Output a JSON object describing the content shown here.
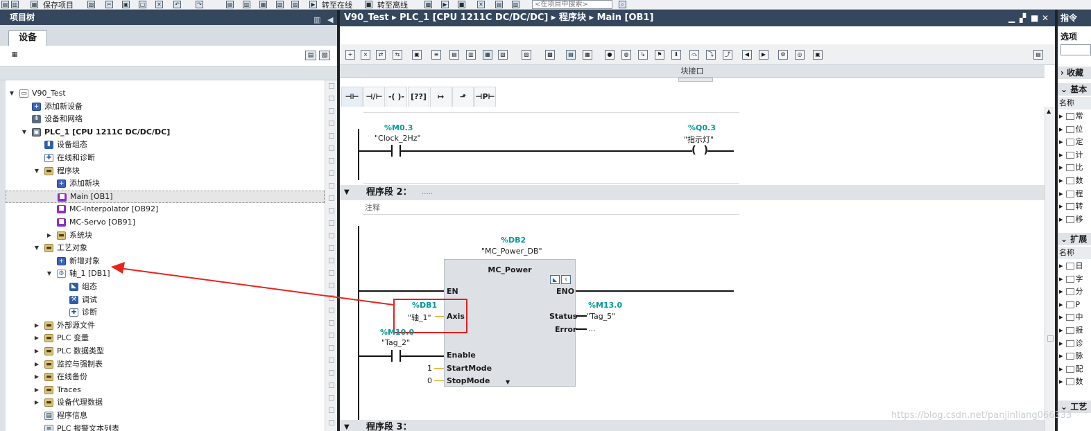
{
  "toolbar": {
    "save_project": "保存项目",
    "go_online": "转至在线",
    "go_offline": "转至离线",
    "search_placeholder": "<在项目中搜索>"
  },
  "left_panel": {
    "title": "项目树",
    "tab": "设备",
    "tree": [
      {
        "label": "V90_Test",
        "depth": 0,
        "arrow": "▼",
        "icon": "doc-icon"
      },
      {
        "label": "添加新设备",
        "depth": 1,
        "arrow": "",
        "icon": "add-device-icon"
      },
      {
        "label": "设备和网络",
        "depth": 1,
        "arrow": "",
        "icon": "network-icon"
      },
      {
        "label": "PLC_1 [CPU 1211C DC/DC/DC]",
        "depth": 1,
        "arrow": "▼",
        "icon": "plc-icon",
        "bold": true
      },
      {
        "label": "设备组态",
        "depth": 2,
        "arrow": "",
        "icon": "device-config-icon"
      },
      {
        "label": "在线和诊断",
        "depth": 2,
        "arrow": "",
        "icon": "diagnostics-icon"
      },
      {
        "label": "程序块",
        "depth": 2,
        "arrow": "▼",
        "icon": "folder-icon"
      },
      {
        "label": "添加新块",
        "depth": 3,
        "arrow": "",
        "icon": "add-block-icon"
      },
      {
        "label": "Main [OB1]",
        "depth": 3,
        "arrow": "",
        "icon": "ob-icon",
        "selected": true
      },
      {
        "label": "MC-Interpolator [OB92]",
        "depth": 3,
        "arrow": "",
        "icon": "ob-icon"
      },
      {
        "label": "MC-Servo [OB91]",
        "depth": 3,
        "arrow": "",
        "icon": "ob-icon"
      },
      {
        "label": "系统块",
        "depth": 3,
        "arrow": "▶",
        "icon": "folder-icon"
      },
      {
        "label": "工艺对象",
        "depth": 2,
        "arrow": "▼",
        "icon": "folder-icon"
      },
      {
        "label": "新增对象",
        "depth": 3,
        "arrow": "",
        "icon": "add-object-icon"
      },
      {
        "label": "轴_1 [DB1]",
        "depth": 3,
        "arrow": "▼",
        "icon": "axis-icon"
      },
      {
        "label": "组态",
        "depth": 4,
        "arrow": "",
        "icon": "config-icon"
      },
      {
        "label": "调试",
        "depth": 4,
        "arrow": "",
        "icon": "commissioning-icon"
      },
      {
        "label": "诊断",
        "depth": 4,
        "arrow": "",
        "icon": "diagnostics-icon"
      },
      {
        "label": "外部源文件",
        "depth": 2,
        "arrow": "▶",
        "icon": "folder-icon"
      },
      {
        "label": "PLC 变量",
        "depth": 2,
        "arrow": "▶",
        "icon": "folder-icon"
      },
      {
        "label": "PLC 数据类型",
        "depth": 2,
        "arrow": "▶",
        "icon": "folder-icon"
      },
      {
        "label": "监控与强制表",
        "depth": 2,
        "arrow": "▶",
        "icon": "folder-icon"
      },
      {
        "label": "在线备份",
        "depth": 2,
        "arrow": "▶",
        "icon": "folder-icon"
      },
      {
        "label": "Traces",
        "depth": 2,
        "arrow": "▶",
        "icon": "folder-icon"
      },
      {
        "label": "设备代理数据",
        "depth": 2,
        "arrow": "▶",
        "icon": "folder-icon"
      },
      {
        "label": "程序信息",
        "depth": 2,
        "arrow": "",
        "icon": "program-info-icon"
      },
      {
        "label": "PLC 报警文本列表",
        "depth": 2,
        "arrow": "",
        "icon": "alarm-text-icon"
      }
    ]
  },
  "main": {
    "breadcrumb": [
      "V90_Test",
      "PLC_1 [CPU 1211C DC/DC/DC]",
      "程序块",
      "Main [OB1]"
    ],
    "block_interface": "块接口",
    "network1": {
      "contact_addr": "%M0.3",
      "contact_tag": "\"Clock_2Hz\"",
      "coil_addr": "%Q0.3",
      "coil_tag": "\"指示灯\""
    },
    "network2": {
      "title": "程序段 2：",
      "dots": ".....",
      "comment": "注释",
      "db_addr": "%DB2",
      "db_name": "\"MC_Power_DB\"",
      "block_name": "MC_Power",
      "en": "EN",
      "eno": "ENO",
      "axis_addr": "%DB1",
      "axis_tag": "\"轴_1\"",
      "axis_pin": "Axis",
      "status_pin": "Status",
      "status_addr": "%M13.0",
      "status_tag": "\"Tag_5\"",
      "error_pin": "Error",
      "error_val": "...",
      "enable_addr": "%M10.0",
      "enable_tag": "\"Tag_2\"",
      "enable_pin": "Enable",
      "startmode_pin": "StartMode",
      "startmode_val": "1",
      "stopmode_pin": "StopMode",
      "stopmode_val": "0"
    },
    "network3_title": "程序段 3："
  },
  "right_panel": {
    "title": "指令",
    "options": "选项",
    "favorites": "收藏",
    "basic": "基本",
    "name_col": "名称",
    "basic_items": [
      "常",
      "位",
      "定",
      "计",
      "比",
      "数",
      "程",
      "转",
      "移"
    ],
    "extended": "扩展",
    "extended_items": [
      "日",
      "字",
      "分",
      "P",
      "中",
      "报",
      "诊",
      "脉",
      "配",
      "数"
    ],
    "tech": "工艺"
  },
  "watermark": "https://blog.csdn.net/panjinliang066333"
}
